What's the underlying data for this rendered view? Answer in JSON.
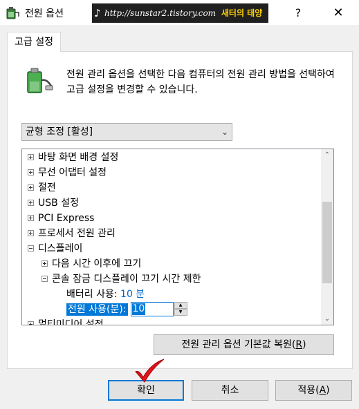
{
  "window": {
    "title": "전원 옵션",
    "help_label": "?",
    "close_label": "✕",
    "icon": "power-options-icon"
  },
  "watermark": {
    "note": "♪",
    "url": "http://sunstar2.tistory.com",
    "name": "새터의 태양"
  },
  "tab": {
    "label": "고급 설정"
  },
  "description": "전원 관리 옵션을 선택한 다음 컴퓨터의 전원 관리 방법을 선택하여 고급 설정을 변경할 수 있습니다.",
  "plan_select": {
    "value": "균형 조정 [활성]"
  },
  "tree": {
    "items": [
      {
        "label": "바탕 화면 배경 설정"
      },
      {
        "label": "무선 어댑터 설정"
      },
      {
        "label": "절전"
      },
      {
        "label": "USB 설정"
      },
      {
        "label": "PCI Express"
      },
      {
        "label": "프로세서 전원 관리"
      },
      {
        "label": "디스플레이"
      },
      {
        "label": "다음 시간 이후에 끄기"
      },
      {
        "label": "콘솔 잠금 디스플레이 끄기 시간 제한"
      },
      {
        "label": "배터리 사용:",
        "value": "10 분"
      },
      {
        "label": "전원 사용(분):",
        "value": "10"
      },
      {
        "label": "멀티미디어 설정"
      }
    ]
  },
  "buttons": {
    "restore_label": "전원 관리 옵션 기본값 복원(",
    "restore_key": "R",
    "restore_suffix": ")",
    "ok_label": "확인",
    "cancel_label": "취소",
    "apply_label": "적용(",
    "apply_key": "A",
    "apply_suffix": ")"
  },
  "colors": {
    "accent": "#0078d7",
    "value_text": "#0066cc",
    "checkmark": "#e0141e"
  }
}
